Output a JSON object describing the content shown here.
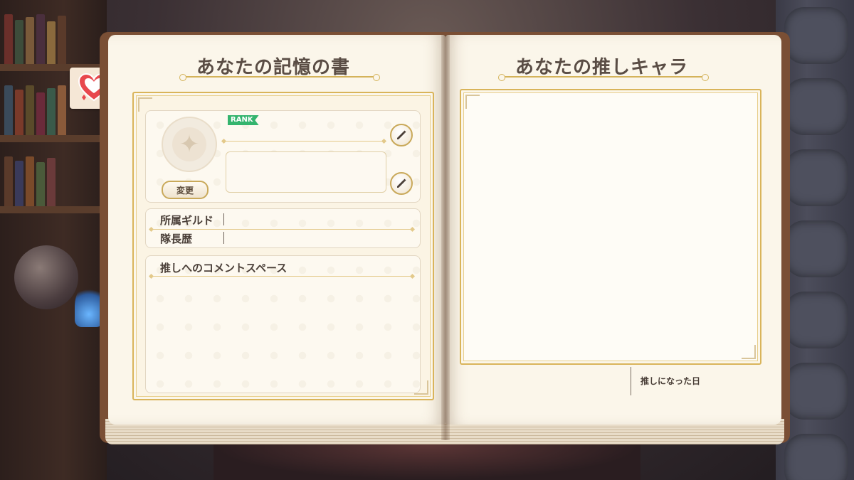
{
  "left_page": {
    "title": "あなたの記憶の書",
    "profile": {
      "rank_label": "RANK",
      "change_button": "変更"
    },
    "info": {
      "guild_label": "所属ギルド",
      "captain_label": "隊長歴"
    },
    "comment": {
      "label": "推しへのコメントスペース"
    }
  },
  "right_page": {
    "title": "あなたの推しキャラ",
    "date_label": "推しになった日"
  },
  "side_tab": {
    "icon": "heart-icon"
  },
  "colors": {
    "gold": "#d9b45a",
    "rank_green": "#34b46e",
    "heart_red": "#e8484e",
    "page": "#fbf6ea"
  }
}
